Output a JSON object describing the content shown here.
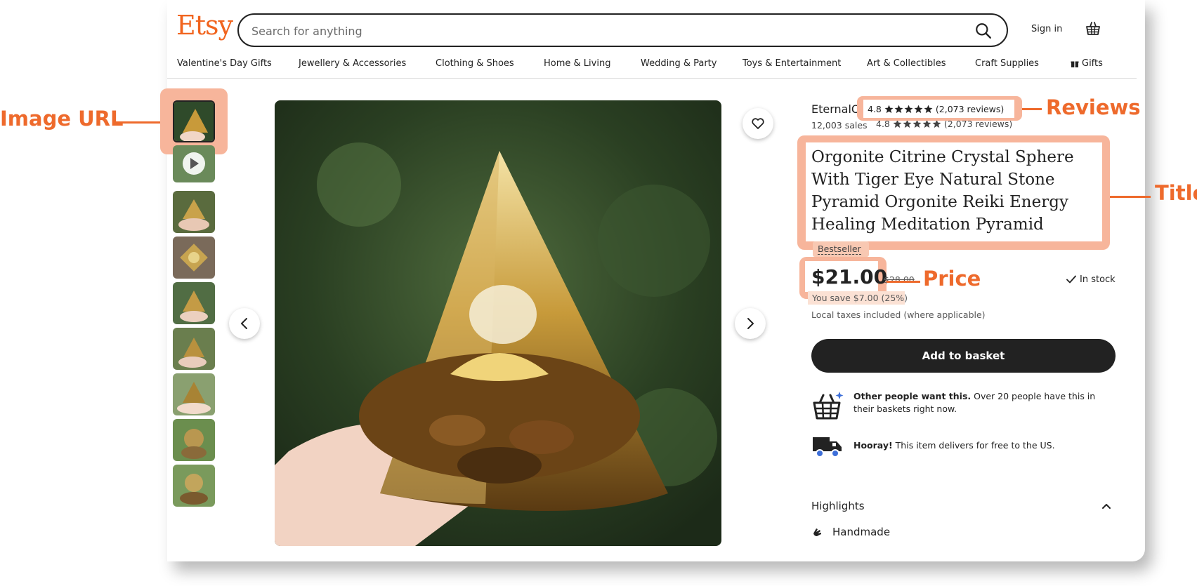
{
  "header": {
    "logo": "Etsy",
    "search_placeholder": "Search for anything",
    "signin": "Sign in"
  },
  "nav": [
    "Valentine's Day Gifts",
    "Jewellery & Accessories",
    "Clothing & Shoes",
    "Home & Living",
    "Wedding & Party",
    "Toys & Entertainment",
    "Art & Collectibles",
    "Craft Supplies",
    "Gifts"
  ],
  "listing": {
    "shop_name": "EternalOrg",
    "sales": "12,003 sales",
    "rating": "4.8",
    "reviews": "(2,073 reviews)",
    "title": "Orgonite Citrine Crystal Sphere With Tiger Eye Natural Stone Pyramid Orgonite Reiki Energy Healing Meditation Pyramid",
    "bestseller": "Bestseller",
    "price": "$21.00",
    "old_price": "$28.00",
    "you_save": "You save $7.00 (25%)",
    "taxes": "Local taxes included (where applicable)",
    "in_stock": "In stock",
    "add_to_basket": "Add to basket",
    "demand_bold": "Other people want this.",
    "demand_text": " Over 20 people have this in their baskets right now.",
    "delivery_bold": "Hooray!",
    "delivery_text": " This item delivers for free to the US.",
    "highlights": "Highlights",
    "handmade": "Handmade"
  },
  "annotations": {
    "image_url": "Image URL",
    "reviews": "Reviews",
    "title": "Title",
    "price": "Price"
  },
  "colors": {
    "accent": "#F1641E",
    "annotation": "#EE6A2C",
    "highlight": "#F7B59B",
    "button_dark": "#222222"
  }
}
